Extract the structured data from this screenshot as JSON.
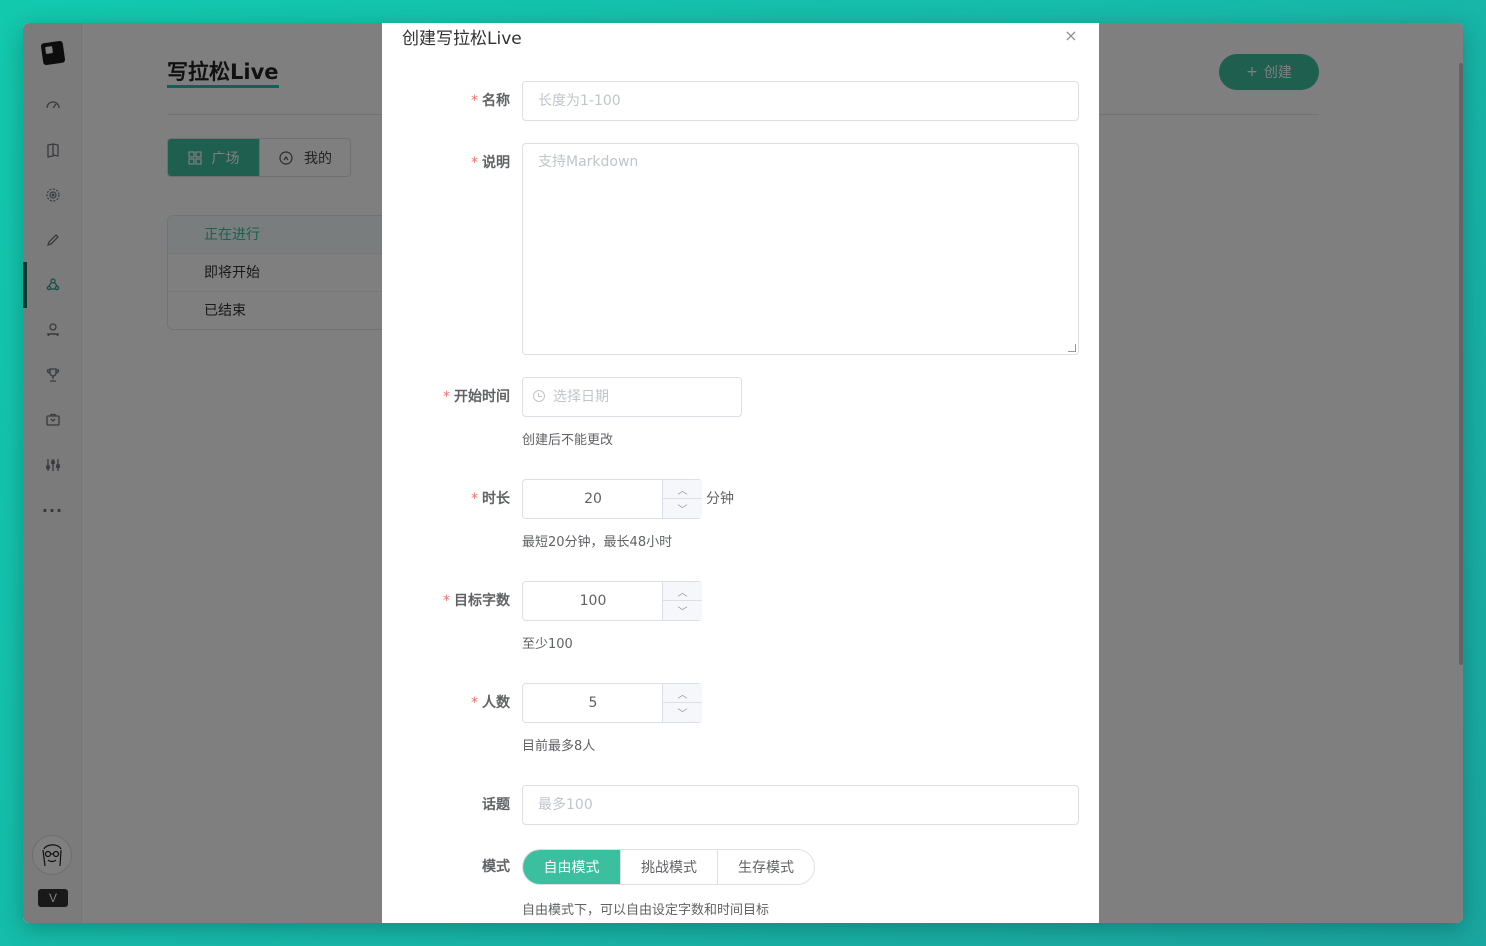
{
  "sidebar": {
    "items": [
      {
        "name": "speedometer-icon"
      },
      {
        "name": "book-icon"
      },
      {
        "name": "target-icon"
      },
      {
        "name": "pencil-icon"
      },
      {
        "name": "people-icon",
        "active": true
      },
      {
        "name": "person-pin-icon"
      },
      {
        "name": "trophy-icon"
      },
      {
        "name": "box-icon"
      },
      {
        "name": "sliders-icon"
      },
      {
        "name": "more-icon",
        "label": "···"
      }
    ],
    "vip_label": "V"
  },
  "page": {
    "title": "写拉松Live",
    "create_label": "创建",
    "tabs": [
      {
        "label": "广场",
        "active": true
      },
      {
        "label": "我的",
        "active": false
      }
    ],
    "status_items": [
      {
        "label": "正在进行",
        "active": true
      },
      {
        "label": "即将开始",
        "active": false
      },
      {
        "label": "已结束",
        "active": false
      }
    ]
  },
  "modal": {
    "title": "创建写拉松Live",
    "close_label": "×",
    "fields": {
      "name": {
        "label": "名称",
        "placeholder": "长度为1-100"
      },
      "desc": {
        "label": "说明",
        "placeholder": "支持Markdown"
      },
      "start": {
        "label": "开始时间",
        "placeholder": "选择日期",
        "hint": "创建后不能更改"
      },
      "duration": {
        "label": "时长",
        "value": "20",
        "unit": "分钟",
        "hint": "最短20分钟，最长48小时"
      },
      "target": {
        "label": "目标字数",
        "value": "100",
        "hint": "至少100"
      },
      "people": {
        "label": "人数",
        "value": "5",
        "hint": "目前最多8人"
      },
      "topic": {
        "label": "话题",
        "placeholder": "最多100"
      },
      "mode": {
        "label": "模式",
        "options": [
          {
            "label": "自由模式",
            "active": true
          },
          {
            "label": "挑战模式",
            "active": false
          },
          {
            "label": "生存模式",
            "active": false
          }
        ],
        "hint": "自由模式下，可以自由设定字数和时间目标"
      }
    }
  },
  "colors": {
    "accent": "#3cbf9f",
    "required": "#f56c6c",
    "background": "#12c9ae"
  }
}
